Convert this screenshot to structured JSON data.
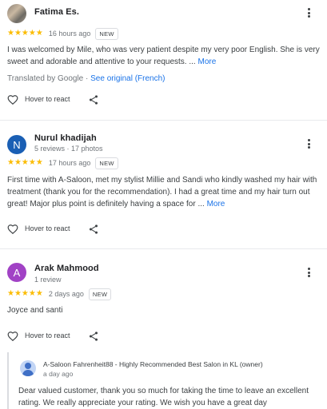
{
  "reviews": [
    {
      "name": "Fatima Es.",
      "stars": "★★★★★",
      "time": "16 hours ago",
      "badge": "NEW",
      "text": "I was welcomed by Mile, who was very patient despite my very poor English. She is very sweet and adorable and attentive to your requests. ...",
      "more": "More",
      "translated_prefix": "Translated by Google ·",
      "see_original": "See original (French)",
      "react": "Hover to react"
    },
    {
      "avatar_letter": "N",
      "name": "Nurul khadijah",
      "meta": "5 reviews · 17 photos",
      "stars": "★★★★★",
      "time": "17 hours ago",
      "badge": "NEW",
      "text": "First time with A-Saloon, met my stylist Millie and Sandi who kindly washed my hair with treatment (thank you for the recommendation). I had a great time and my hair turn out great! Major plus point is definitely having a space for ...",
      "more": "More",
      "react": "Hover to react"
    },
    {
      "avatar_letter": "A",
      "name": "Arak Mahmood",
      "meta": "1 review",
      "stars": "★★★★★",
      "time": "2 days ago",
      "badge": "NEW",
      "text": "Joyce and santi",
      "react": "Hover to react",
      "owner_response": {
        "name": "A-Saloon Fahrenheit88 - Highly Recommended Best Salon in KL (owner)",
        "time": "a day ago",
        "text": "Dear valued customer, thank you so much for taking the time to leave an excellent rating. We really appreciate your rating. We wish you have a great day"
      }
    }
  ],
  "colors": {
    "star": "#fbbc04",
    "link": "#1a73e8",
    "avatar_n": "#1a5fb4",
    "avatar_a": "#a142c5"
  },
  "icons": {
    "menu": "more-vert-icon",
    "react": "heart-outline-icon",
    "share": "share-icon"
  }
}
